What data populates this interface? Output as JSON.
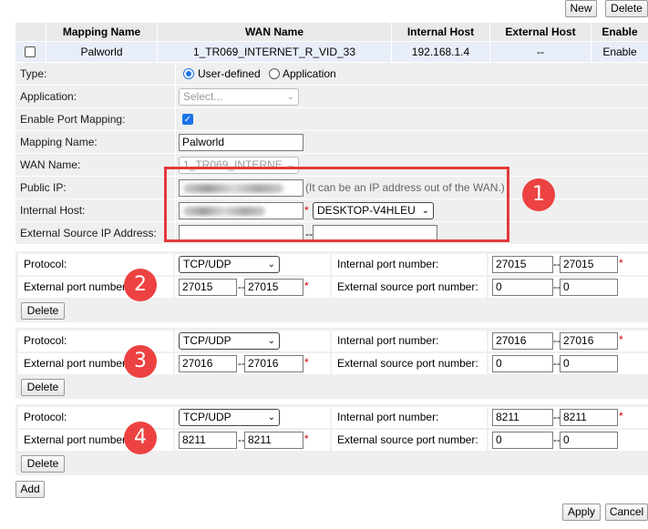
{
  "toolbar": {
    "new_label": "New",
    "delete_label": "Delete"
  },
  "table": {
    "headers": [
      "Mapping Name",
      "WAN Name",
      "Internal Host",
      "External Host",
      "Enable"
    ],
    "row": {
      "mapping_name": "Palworld",
      "wan_name": "1_TR069_INTERNET_R_VID_33",
      "internal_host": "192.168.1.4",
      "external_host": "--",
      "enable": "Enable"
    }
  },
  "form": {
    "type_label": "Type:",
    "type_option_user": "User-defined",
    "type_option_app": "Application",
    "application_label": "Application:",
    "application_placeholder": "Select...",
    "enable_label": "Enable Port Mapping:",
    "mapping_name_label": "Mapping Name:",
    "mapping_name_value": "Palworld",
    "wan_name_label": "WAN Name:",
    "wan_name_value": "1_TR069_INTERNE",
    "public_ip_label": "Public IP:",
    "public_ip_hint": "(It can be an IP address out of the WAN.)",
    "internal_host_label": "Internal Host:",
    "internal_host_device": "DESKTOP-V4HLEU",
    "ext_src_ip_label": "External Source IP Address:"
  },
  "groups": [
    {
      "protocol_label": "Protocol:",
      "protocol": "TCP/UDP",
      "internal_port_label": "Internal port number:",
      "int_from": "27015",
      "int_to": "27015",
      "external_port_label": "External port number:",
      "ext_from": "27015",
      "ext_to": "27015",
      "ext_src_port_label": "External source port number:",
      "src_from": "0",
      "src_to": "0",
      "delete_label": "Delete",
      "badge": "2"
    },
    {
      "protocol_label": "Protocol:",
      "protocol": "TCP/UDP",
      "internal_port_label": "Internal port number:",
      "int_from": "27016",
      "int_to": "27016",
      "external_port_label": "External port number:",
      "ext_from": "27016",
      "ext_to": "27016",
      "ext_src_port_label": "External source port number:",
      "src_from": "0",
      "src_to": "0",
      "delete_label": "Delete",
      "badge": "3"
    },
    {
      "protocol_label": "Protocol:",
      "protocol": "TCP/UDP",
      "internal_port_label": "Internal port number:",
      "int_from": "8211",
      "int_to": "8211",
      "external_port_label": "External port number:",
      "ext_from": "8211",
      "ext_to": "8211",
      "ext_src_port_label": "External source port number:",
      "src_from": "0",
      "src_to": "0",
      "delete_label": "Delete",
      "badge": "4"
    }
  ],
  "annotation_badge_1": "1",
  "footer": {
    "add_label": "Add",
    "apply_label": "Apply",
    "cancel_label": "Cancel"
  },
  "colors": {
    "annotation_red": "#e5393b",
    "accent_blue": "#1a73e8"
  }
}
